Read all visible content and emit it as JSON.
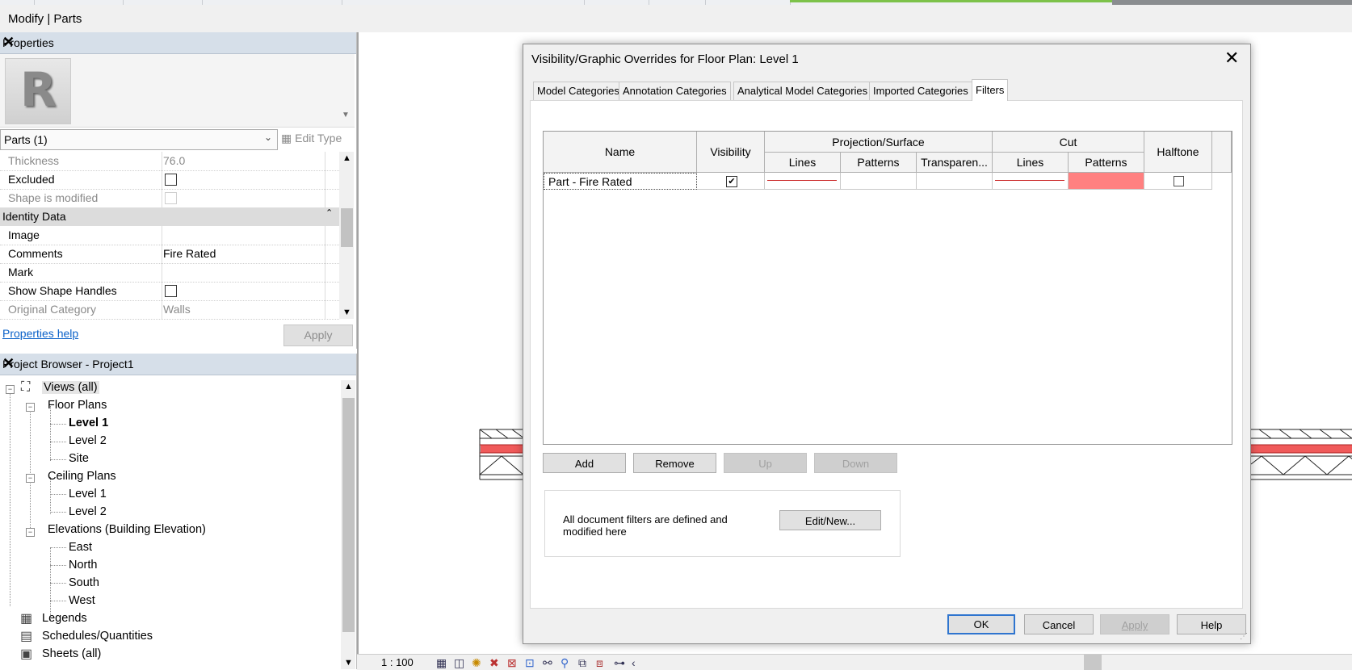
{
  "context_tab": "Modify | Parts",
  "properties": {
    "title": "Properties",
    "type_selector": "Parts (1)",
    "edit_type": "Edit Type",
    "rows": [
      {
        "label": "Thickness",
        "value": "76.0",
        "dim": true
      },
      {
        "label": "Excluded",
        "value": "",
        "checkbox": true
      },
      {
        "label": "Shape is modified",
        "value": "",
        "checkbox": true,
        "dim": true
      }
    ],
    "group": "Identity Data",
    "identity_rows": [
      {
        "label": "Image",
        "value": ""
      },
      {
        "label": "Comments",
        "value": "Fire Rated"
      },
      {
        "label": "Mark",
        "value": ""
      },
      {
        "label": "Show Shape Handles",
        "value": "",
        "checkbox": true
      },
      {
        "label": "Original Category",
        "value": "Walls",
        "dim": true
      }
    ],
    "help_link": "Properties help",
    "apply": "Apply"
  },
  "browser": {
    "title": "Project Browser - Project1",
    "views_all": "Views (all)",
    "floor_plans": "Floor Plans",
    "floor_items": [
      "Level 1",
      "Level 2",
      "Site"
    ],
    "ceiling_plans": "Ceiling Plans",
    "ceiling_items": [
      "Level 1",
      "Level 2"
    ],
    "elevations": "Elevations (Building Elevation)",
    "elevation_items": [
      "East",
      "North",
      "South",
      "West"
    ],
    "legends": "Legends",
    "schedules": "Schedules/Quantities",
    "sheets": "Sheets (all)"
  },
  "status": {
    "scale": "1 : 100"
  },
  "dialog": {
    "title": "Visibility/Graphic Overrides for Floor Plan: Level 1",
    "tabs": [
      "Model Categories",
      "Annotation Categories",
      "Analytical Model Categories",
      "Imported Categories",
      "Filters"
    ],
    "active_tab": "Filters",
    "headers": {
      "name": "Name",
      "visibility": "Visibility",
      "projection": "Projection/Surface",
      "cut": "Cut",
      "halftone": "Halftone",
      "lines": "Lines",
      "patterns": "Patterns",
      "transparency": "Transparen..."
    },
    "filters": [
      {
        "name": "Part - Fire Rated",
        "visible": true,
        "cut_pattern_color": "#ff8080",
        "line_color": "#cc2b2b",
        "halftone": false
      }
    ],
    "buttons": {
      "add": "Add",
      "remove": "Remove",
      "up": "Up",
      "down": "Down"
    },
    "info_text": "All document filters are defined and modified here",
    "edit_new": "Edit/New...",
    "ok": "OK",
    "cancel": "Cancel",
    "apply": "Apply",
    "help": "Help"
  }
}
